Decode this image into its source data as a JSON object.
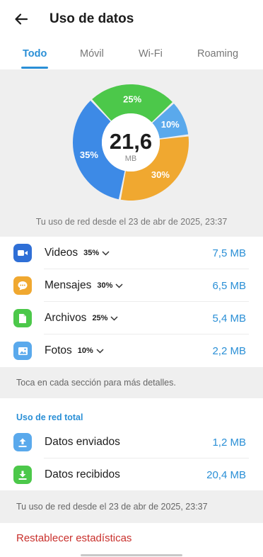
{
  "header": {
    "title": "Uso de datos"
  },
  "tabs": [
    {
      "label": "Todo",
      "active": true
    },
    {
      "label": "Móvil",
      "active": false
    },
    {
      "label": "Wi-Fi",
      "active": false
    },
    {
      "label": "Roaming",
      "active": false
    }
  ],
  "chart_data": {
    "type": "pie",
    "center_value": "21,6",
    "center_unit": "MB",
    "slices": [
      {
        "label": "35%",
        "value": 35,
        "color": "#3d8ae6"
      },
      {
        "label": "25%",
        "value": 25,
        "color": "#4cc84a"
      },
      {
        "label": "10%",
        "value": 10,
        "color": "#5aa9ec"
      },
      {
        "label": "30%",
        "value": 30,
        "color": "#f0a830"
      }
    ]
  },
  "usage_since": "Tu uso de red desde el 23 de abr de 2025, 23:37",
  "categories": [
    {
      "label": "Videos",
      "pct": "35%",
      "value": "7,5 MB",
      "icon": "video-icon",
      "color": "#2f6fd6"
    },
    {
      "label": "Mensajes",
      "pct": "30%",
      "value": "6,5 MB",
      "icon": "message-icon",
      "color": "#f0a830"
    },
    {
      "label": "Archivos",
      "pct": "25%",
      "value": "5,4 MB",
      "icon": "file-icon",
      "color": "#4cc84a"
    },
    {
      "label": "Fotos",
      "pct": "10%",
      "value": "2,2 MB",
      "icon": "photo-icon",
      "color": "#5aa9ec"
    }
  ],
  "hint": "Toca en cada sección para más detalles.",
  "total_section": {
    "title": "Uso de red total",
    "rows": [
      {
        "label": "Datos enviados",
        "value": "1,2 MB",
        "icon": "upload-icon",
        "color": "#5aa9ec"
      },
      {
        "label": "Datos recibidos",
        "value": "20,4 MB",
        "icon": "download-icon",
        "color": "#4cc84a"
      }
    ]
  },
  "usage_since_bottom": "Tu uso de red desde el 23 de abr de 2025, 23:37",
  "reset_label": "Restablecer estadísticas"
}
